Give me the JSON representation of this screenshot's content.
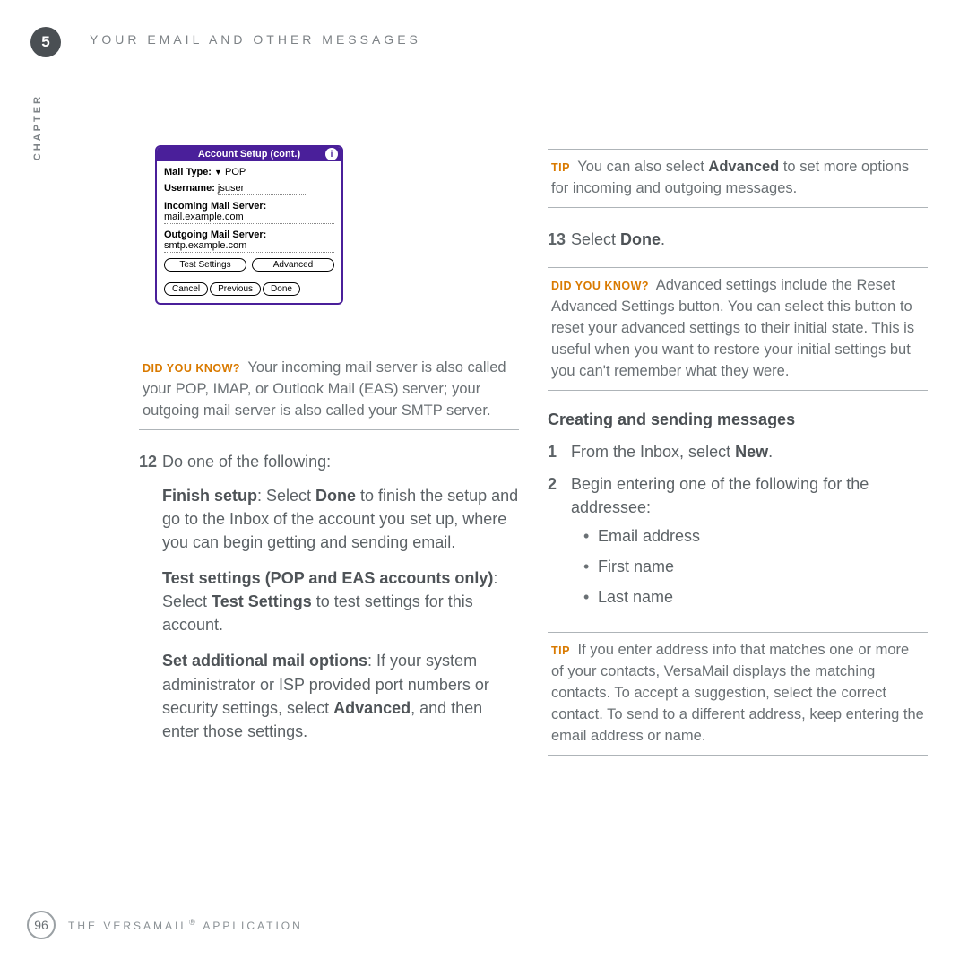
{
  "header": {
    "chapter_number": "5",
    "title": "YOUR EMAIL AND OTHER MESSAGES",
    "side_label": "CHAPTER"
  },
  "palm": {
    "title": "Account Setup (cont.)",
    "info_icon": "i",
    "mail_type_lbl": "Mail Type:",
    "mail_type_val": "POP",
    "username_lbl": "Username:",
    "username_val": "jsuser",
    "incoming_lbl": "Incoming Mail Server:",
    "incoming_val": "mail.example.com",
    "outgoing_lbl": "Outgoing Mail Server:",
    "outgoing_val": "smtp.example.com",
    "btn_test": "Test Settings",
    "btn_advanced": "Advanced",
    "btn_cancel": "Cancel",
    "btn_previous": "Previous",
    "btn_done": "Done"
  },
  "left": {
    "dyk1_tag": "DID YOU KNOW?",
    "dyk1_text": "Your incoming mail server is also called your POP, IMAP, or Outlook Mail (EAS) server; your outgoing mail server is also called your SMTP server.",
    "step12_num": "12",
    "step12_text": "Do one of the following:",
    "finish_strong": "Finish setup",
    "finish_text1": ": Select ",
    "finish_done": "Done",
    "finish_text2": " to finish the setup and go to the Inbox of the account you set up, where you can begin getting and sending email.",
    "test_strong": "Test settings (POP and EAS accounts only)",
    "test_text1": ": Select ",
    "test_link": "Test Settings",
    "test_text2": " to test settings for this account.",
    "addl_strong": "Set additional mail options",
    "addl_text1": ": If your system administrator or ISP provided port numbers or security settings, select ",
    "addl_link": "Advanced",
    "addl_text2": ", and then enter those settings."
  },
  "right": {
    "tip1_tag": "TIP",
    "tip1_text1": "You can also select ",
    "tip1_strong": "Advanced",
    "tip1_text2": " to set more options for incoming and outgoing messages.",
    "step13_num": "13",
    "step13_text1": "Select ",
    "step13_done": "Done",
    "step13_text2": ".",
    "dyk2_tag": "DID YOU KNOW?",
    "dyk2_text": "Advanced settings include the Reset Advanced Settings button. You can select this button to reset your advanced settings to their initial state. This is useful when you want to restore your initial settings but you can't remember what they were.",
    "heading": "Creating and sending messages",
    "s1_num": "1",
    "s1_text1": "From the Inbox, select ",
    "s1_new": "New",
    "s1_text2": ".",
    "s2_num": "2",
    "s2_text": "Begin entering one of the following for the addressee:",
    "b1": "Email address",
    "b2": "First name",
    "b3": "Last name",
    "tip2_tag": "TIP",
    "tip2_text": "If you enter address info that matches one or more of your contacts, VersaMail displays the matching contacts. To accept a suggestion, select the correct contact. To send to a different address, keep entering the email address or name."
  },
  "footer": {
    "page": "96",
    "text1": "THE VERSAMAIL",
    "reg": "®",
    "text2": " APPLICATION"
  }
}
